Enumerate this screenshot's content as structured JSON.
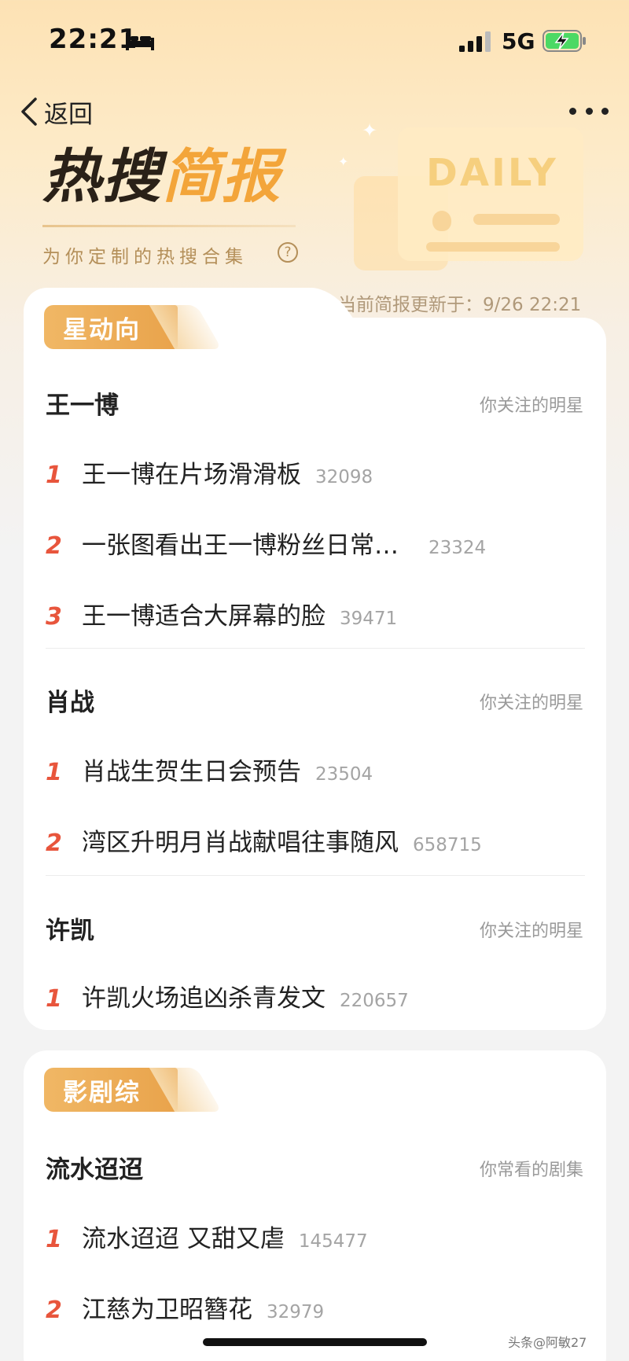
{
  "status_bar": {
    "time": "22:21",
    "network": "5G"
  },
  "nav": {
    "back_label": "返回"
  },
  "header": {
    "title_part1": "热搜",
    "title_part2": "简报",
    "subtitle": "为你定制的热搜合集",
    "illustration_word": "DAILY",
    "update_time": "当前简报更新于：9/26 22:21"
  },
  "sections": [
    {
      "tag": "星动向",
      "groups": [
        {
          "title": "王一博",
          "note": "你关注的明星",
          "items": [
            {
              "rank": "1",
              "text": "王一博在片场滑滑板",
              "count": "32098"
            },
            {
              "rank": "2",
              "text": "一张图看出王一博粉丝日常…",
              "count": "23324"
            },
            {
              "rank": "3",
              "text": "王一博适合大屏幕的脸",
              "count": "39471"
            }
          ]
        },
        {
          "title": "肖战",
          "note": "你关注的明星",
          "items": [
            {
              "rank": "1",
              "text": "肖战生贺生日会预告",
              "count": "23504"
            },
            {
              "rank": "2",
              "text": "湾区升明月肖战献唱往事随风",
              "count": "658715"
            }
          ]
        },
        {
          "title": "许凯",
          "note": "你关注的明星",
          "items": [
            {
              "rank": "1",
              "text": "许凯火场追凶杀青发文",
              "count": "220657"
            }
          ]
        }
      ]
    },
    {
      "tag": "影剧综",
      "groups": [
        {
          "title": "流水迢迢",
          "note": "你常看的剧集",
          "items": [
            {
              "rank": "1",
              "text": "流水迢迢 又甜又虐",
              "count": "145477"
            },
            {
              "rank": "2",
              "text": "江慈为卫昭簪花",
              "count": "32979"
            }
          ]
        }
      ]
    }
  ],
  "watermark": "头条@阿敏27",
  "colors": {
    "accent": "#f3a53a",
    "rank": "#e8553c",
    "tag": "#e9a34b"
  }
}
